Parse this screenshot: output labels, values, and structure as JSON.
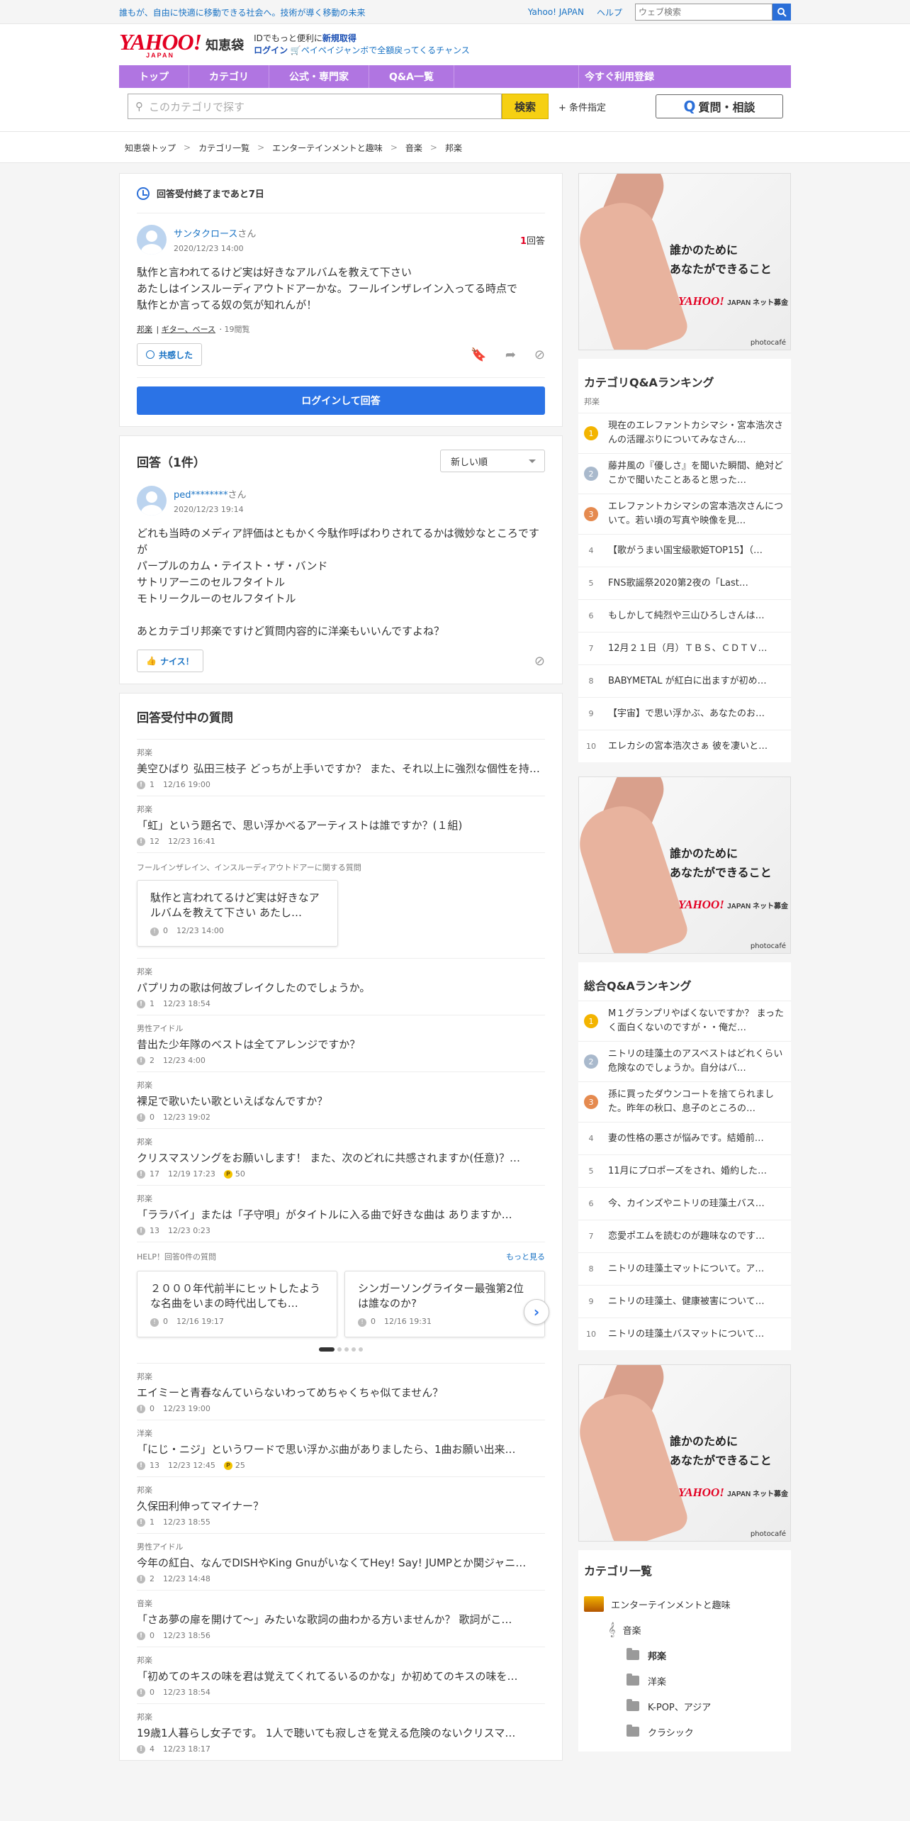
{
  "topbar": {
    "tagline": "誰もが、自由に快適に移動できる社会へ。技術が導く移動の未来",
    "links": [
      "Yahoo! JAPAN",
      "ヘルプ"
    ],
    "search_placeholder": "ウェブ検索"
  },
  "header": {
    "logo": "YAHOO!",
    "logo_sub": "JAPAN",
    "service": "知恵袋",
    "note1_pre": "IDでもっと便利に",
    "note1_link": "新規取得",
    "note2_login": "ログイン",
    "note2_promo": "ペイペイジャンボで全額戻ってくるチャンス"
  },
  "nav": {
    "items": [
      "トップ",
      "カテゴリ",
      "公式・専門家",
      "Q&A一覧"
    ],
    "right": "今すぐ利用登録"
  },
  "search": {
    "placeholder": "このカテゴリで探す",
    "button": "検索",
    "cond": "+ 条件指定",
    "ask": "質問・相談"
  },
  "breadcrumbs": [
    "知恵袋トップ",
    "カテゴリ一覧",
    "エンターテインメントと趣味",
    "音楽",
    "邦楽"
  ],
  "question": {
    "deadline": "回答受付終了まであと7日",
    "user": "サンタクロース",
    "user_suffix": "さん",
    "date": "2020/12/23 14:00",
    "answer_count": "1",
    "answer_label": "回答",
    "body": [
      "駄作と言われてるけど実は好きなアルバムを教えて下さい",
      "あたしはインスルーディアウトドアーかな。フールインザレイン入ってる時点で",
      "駄作とか言ってる奴の気が知れんが！"
    ],
    "tags": [
      "邦楽",
      "ギター、ベース"
    ],
    "views": "19閲覧",
    "empathy": "共感した",
    "login_answer": "ログインして回答"
  },
  "answers": {
    "title": "回答（1件）",
    "sort": "新しい順",
    "items": [
      {
        "user": "ped********",
        "suffix": "さん",
        "date": "2020/12/23 19:14",
        "body": [
          "どれも当時のメディア評価はともかく今駄作呼ばわりされてるかは微妙なところですが",
          "パープルのカム・テイスト・ザ・バンド",
          "サトリアーニのセルフタイトル",
          "モトリークルーのセルフタイトル",
          "",
          "あとカテゴリ邦楽ですけど質問内容的に洋楽もいいんですよね？"
        ],
        "nice": "ナイス！"
      }
    ]
  },
  "open_questions": {
    "title": "回答受付中の質問",
    "items_a": [
      {
        "cat": "邦楽",
        "title": "美空ひばり 弘田三枝子 どっちが上手いですか？ また、それ以上に強烈な個性を持った…",
        "count": "1",
        "date": "12/16 19:00"
      },
      {
        "cat": "邦楽",
        "title": "「虹」という題名で、思い浮かべるアーティストは誰ですか？(１組)",
        "count": "12",
        "date": "12/23 16:41"
      }
    ],
    "related_label": "フールインザレイン、インスルーディアウトドアーに関する質問",
    "related": {
      "title": "駄作と言われてるけど実は好きなアルバムを教えて下さい あたし…",
      "count": "0",
      "date": "12/23 14:00"
    },
    "items_b": [
      {
        "cat": "邦楽",
        "title": "パプリカの歌は何故ブレイクしたのでしょうか。",
        "count": "1",
        "date": "12/23 18:54"
      },
      {
        "cat": "男性アイドル",
        "title": "昔出た少年隊のベストは全てアレンジですか？",
        "count": "2",
        "date": "12/23 4:00"
      },
      {
        "cat": "邦楽",
        "title": "裸足で歌いたい歌といえばなんですか？",
        "count": "0",
        "date": "12/23 19:02"
      },
      {
        "cat": "邦楽",
        "title": "クリスマスソングをお願いします！ また、次のどれに共感されますか(任意)？…",
        "count": "17",
        "date": "12/19 17:23",
        "coin": "50"
      },
      {
        "cat": "邦楽",
        "title": "「ララバイ」または「子守唄」がタイトルに入る曲で好きな曲は ありますか…",
        "count": "13",
        "date": "12/23 0:23"
      }
    ],
    "help_label": "HELP！回答0件の質問",
    "help_more": "もっと見る",
    "help_cards": [
      {
        "title": "２０００年代前半にヒットしたような名曲をいまの時代出しても…",
        "count": "0",
        "date": "12/16 19:17"
      },
      {
        "title": "シンガーソングライター最強第2位は誰なのか?",
        "count": "0",
        "date": "12/16 19:31"
      }
    ],
    "items_c": [
      {
        "cat": "邦楽",
        "title": "エイミーと青春なんていらないわってめちゃくちゃ似てません？",
        "count": "0",
        "date": "12/23 19:00"
      },
      {
        "cat": "洋楽",
        "title": "「にじ・ニジ」というワードで思い浮かぶ曲がありましたら、1曲お願い出来…",
        "count": "13",
        "date": "12/23 12:45",
        "coin": "25"
      },
      {
        "cat": "邦楽",
        "title": "久保田利伸ってマイナー？",
        "count": "1",
        "date": "12/23 18:55"
      },
      {
        "cat": "男性アイドル",
        "title": "今年の紅白、なんでDISHやKing GnuがいなくてHey! Say! JUMPとか関ジャニ…",
        "count": "2",
        "date": "12/23 14:48"
      },
      {
        "cat": "音楽",
        "title": "「さあ夢の扉を開けて〜」みたいな歌詞の曲わかる方いませんか？ 歌詞がこ…",
        "count": "0",
        "date": "12/23 18:56"
      },
      {
        "cat": "邦楽",
        "title": "「初めてのキスの味を君は覚えてくれてるいるのかな」か初めてのキスの味を…",
        "count": "0",
        "date": "12/23 18:54"
      },
      {
        "cat": "邦楽",
        "title": "19歳1人暮らし女子です。 1人で聴いても寂しさを覚える危険のないクリスマ…",
        "count": "4",
        "date": "12/23 18:17"
      }
    ]
  },
  "ad": {
    "copy1": "誰かのために",
    "copy2": "あなたができること",
    "brand": "YAHOO!",
    "brand_sub": "JAPAN ネット募金",
    "credit": "photocafé"
  },
  "cat_ranking": {
    "title": "カテゴリQ&Aランキング",
    "sub": "邦楽",
    "items": [
      "現在のエレファントカシマシ・宮本浩次さんの活躍ぶりについてみなさん…",
      "藤井風の『優しさ』を聞いた瞬間、絶対どこかで聞いたことあると思った…",
      "エレファントカシマシの宮本浩次さんについて。若い頃の写真や映像を見…",
      "【歌がうまい国宝級歌姫TOP15】（…",
      "FNS歌謡祭2020第2夜の「Last…",
      "もしかして純烈や三山ひろしさんは…",
      "12月２１日（月）ＴＢＳ、ＣＤＴＶ…",
      "BABYMETAL が紅白に出ますが初め…",
      "【宇宙】で思い浮かぶ、あなたのお…",
      "エレカシの宮本浩次さぁ 彼を凄いと…"
    ]
  },
  "all_ranking": {
    "title": "総合Q&Aランキング",
    "items": [
      "M１グランプリやばくないですか？ まったく面白くないのですが・・俺だ…",
      "ニトリの珪藻土のアスベストはどれくらい危険なのでしょうか。自分はバ…",
      "孫に買ったダウンコートを捨てられました。昨年の秋口、息子のところの…",
      "妻の性格の悪さが悩みです。結婚前…",
      "11月にプロポーズをされ、婚約した…",
      "今、カインズやニトリの珪藻土バス…",
      "恋愛ポエムを読むのが趣味なのです…",
      "ニトリの珪藻土マットについて。ア…",
      "ニトリの珪藻土、健康被害について…",
      "ニトリの珪藻土バスマットについて…"
    ]
  },
  "categories": {
    "title": "カテゴリ一覧",
    "root": "エンターテインメントと趣味",
    "sub": "音楽",
    "items": [
      "邦楽",
      "洋楽",
      "K-POP、アジア",
      "クラシック"
    ]
  },
  "colors": {
    "accent": "#b075e1",
    "link": "#1a73c4",
    "brand": "#e30022",
    "primary": "#2b73e6"
  }
}
